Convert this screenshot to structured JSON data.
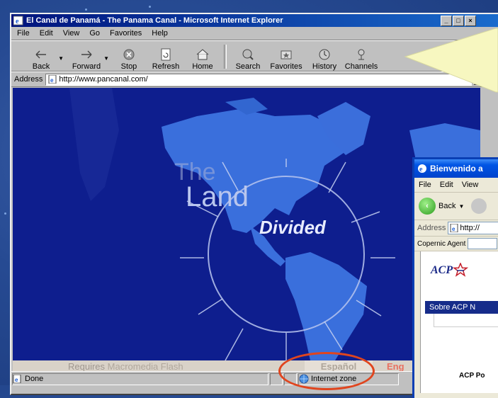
{
  "window": {
    "title": "El Canal de Panamá - The Panama Canal - Microsoft Internet Explorer",
    "controls": [
      "_",
      "□",
      "×"
    ]
  },
  "menu": [
    "File",
    "Edit",
    "View",
    "Go",
    "Favorites",
    "Help"
  ],
  "toolbar": {
    "back": "Back",
    "forward": "Forward",
    "stop": "Stop",
    "refresh": "Refresh",
    "home": "Home",
    "search": "Search",
    "favorites": "Favorites",
    "history": "History",
    "channels": "Channels"
  },
  "address": {
    "label": "Address",
    "url": "http://www.pancanal.com/"
  },
  "page": {
    "the": "The",
    "land": "Land",
    "divided": "Divided",
    "requires_prefix": "Requires",
    "requires_product": "Macromedia Flash",
    "espanol": "Español",
    "english": "Eng"
  },
  "status": {
    "text": "Done",
    "zone": "Internet zone"
  },
  "colors": {
    "accent_circle": "#e0451e",
    "callout": "#f7f7c0",
    "page_bg": "#0e1e8e"
  },
  "second_window": {
    "title": "Bienvenido a",
    "menu": [
      "File",
      "Edit",
      "View"
    ],
    "back": "Back",
    "address_label": "Address",
    "url": "http://",
    "copernic": "Copernic Agent",
    "logo": "ACP",
    "nav": "Sobre ACP N",
    "bottom": "ACP Po"
  }
}
